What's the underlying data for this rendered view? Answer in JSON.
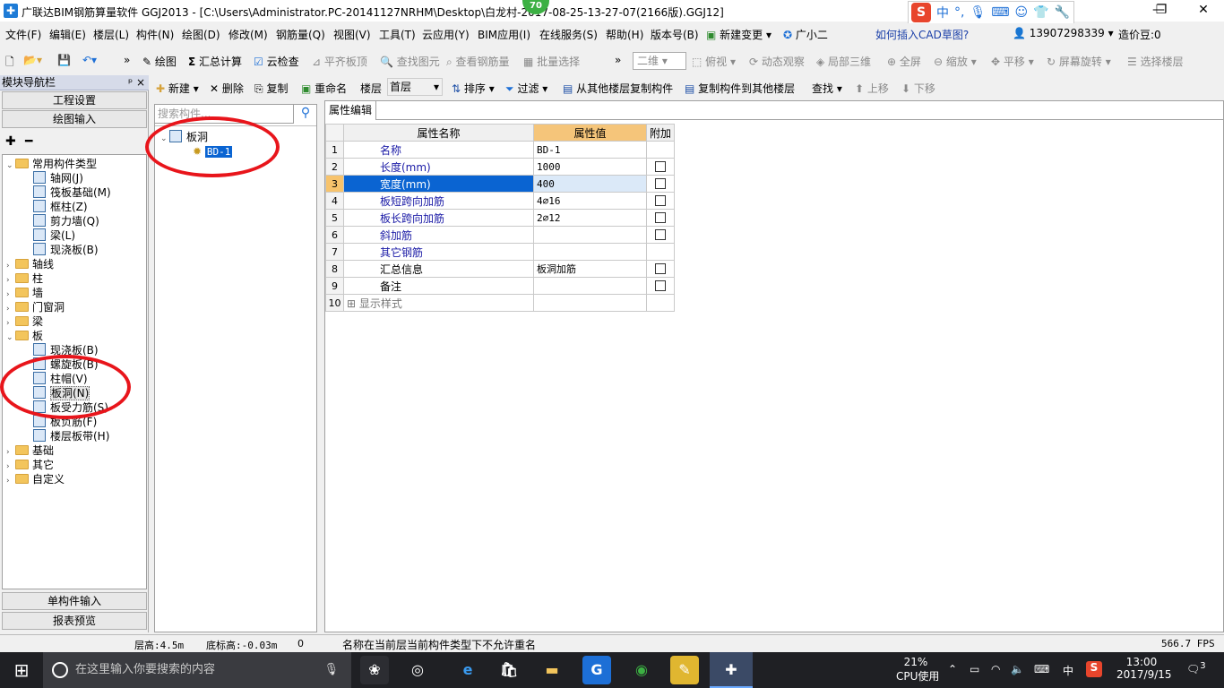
{
  "window": {
    "title": "广联达BIM钢筋算量软件 GGJ2013 - [C:\\Users\\Administrator.PC-20141127NRHM\\Desktop\\白龙村-2017-08-25-13-27-07(2166版).GGJ12]",
    "badge": "70",
    "ime": "中"
  },
  "menu": {
    "items": [
      "文件(F)",
      "编辑(E)",
      "楼层(L)",
      "构件(N)",
      "绘图(D)",
      "修改(M)",
      "钢筋量(Q)",
      "视图(V)",
      "工具(T)",
      "云应用(Y)",
      "BIM应用(I)",
      "在线服务(S)",
      "帮助(H)",
      "版本号(B)",
      "新建变更",
      "广小二"
    ],
    "cad_link": "如何插入CAD草图?",
    "phone": "13907298339",
    "price_bean": "造价豆:0"
  },
  "toolbar1": {
    "items": [
      "绘图",
      "汇总计算",
      "云检查",
      "平齐板顶",
      "查找图元",
      "查看钢筋量",
      "批量选择",
      "二维",
      "俯视",
      "动态观察",
      "局部三维",
      "全屏",
      "缩放",
      "平移",
      "屏幕旋转",
      "选择楼层"
    ]
  },
  "toolbar2": {
    "items": [
      "新建",
      "删除",
      "复制",
      "重命名",
      "楼层",
      "首层",
      "排序",
      "过滤",
      "从其他楼层复制构件",
      "复制构件到其他楼层",
      "查找",
      "上移",
      "下移"
    ]
  },
  "left": {
    "header": "模块导航栏",
    "pin": "ᵖ ×",
    "project_settings": "工程设置",
    "draw_input": "绘图输入",
    "single_input": "单构件输入",
    "report_preview": "报表预览",
    "tree": [
      {
        "label": "常用构件类型",
        "level": 0,
        "expanded": true
      },
      {
        "label": "轴网(J)",
        "level": 1
      },
      {
        "label": "筏板基础(M)",
        "level": 1
      },
      {
        "label": "框柱(Z)",
        "level": 1
      },
      {
        "label": "剪力墙(Q)",
        "level": 1
      },
      {
        "label": "梁(L)",
        "level": 1
      },
      {
        "label": "现浇板(B)",
        "level": 1
      },
      {
        "label": "轴线",
        "level": 0
      },
      {
        "label": "柱",
        "level": 0
      },
      {
        "label": "墙",
        "level": 0
      },
      {
        "label": "门窗洞",
        "level": 0
      },
      {
        "label": "梁",
        "level": 0
      },
      {
        "label": "板",
        "level": 0,
        "expanded": true
      },
      {
        "label": "现浇板(B)",
        "level": 1
      },
      {
        "label": "螺旋板(B)",
        "level": 1
      },
      {
        "label": "柱帽(V)",
        "level": 1
      },
      {
        "label": "板洞(N)",
        "level": 1,
        "selected": true
      },
      {
        "label": "板受力筋(S)",
        "level": 1
      },
      {
        "label": "板负筋(F)",
        "level": 1
      },
      {
        "label": "楼层板带(H)",
        "level": 1
      },
      {
        "label": "基础",
        "level": 0
      },
      {
        "label": "其它",
        "level": 0
      },
      {
        "label": "自定义",
        "level": 0
      }
    ]
  },
  "middle": {
    "search_placeholder": "搜索构件...",
    "root": "板洞",
    "child": "BD-1"
  },
  "right": {
    "tab": "属性编辑",
    "headers": {
      "name": "属性名称",
      "value": "属性值",
      "extra": "附加"
    },
    "rows": [
      {
        "no": "1",
        "name": "名称",
        "value": "BD-1",
        "check": false,
        "blue": true
      },
      {
        "no": "2",
        "name": "长度(mm)",
        "value": "1000",
        "check": true,
        "blue": true
      },
      {
        "no": "3",
        "name": "宽度(mm)",
        "value": "400",
        "check": true,
        "blue": true,
        "selected": true
      },
      {
        "no": "4",
        "name": "板短跨向加筋",
        "value": "4⌀16",
        "check": true,
        "blue": true
      },
      {
        "no": "5",
        "name": "板长跨向加筋",
        "value": "2⌀12",
        "check": true,
        "blue": true
      },
      {
        "no": "6",
        "name": "斜加筋",
        "value": "",
        "check": true,
        "blue": true
      },
      {
        "no": "7",
        "name": "其它钢筋",
        "value": "",
        "check": false,
        "blue": true
      },
      {
        "no": "8",
        "name": "汇总信息",
        "value": "板洞加筋",
        "check": true,
        "blue": false
      },
      {
        "no": "9",
        "name": "备注",
        "value": "",
        "check": true,
        "blue": false
      },
      {
        "no": "10",
        "name": "显示样式",
        "value": "",
        "check": false,
        "blue": false,
        "expander": true
      }
    ]
  },
  "status": {
    "floor_height": "层高:4.5m",
    "base_height": "底标高:-0.03m",
    "zero": "0",
    "message": "名称在当前层当前构件类型下不允许重名",
    "fps": "566.7 FPS"
  },
  "taskbar": {
    "search_placeholder": "在这里输入你要搜索的内容",
    "cpu_percent": "21%",
    "cpu_label": "CPU使用",
    "ime": "中",
    "time": "13:00",
    "date": "2017/9/15",
    "notif": "3"
  },
  "colors": {
    "accent": "#0a64d2",
    "annotation": "#e8151b",
    "header_value": "#f5c57a"
  }
}
